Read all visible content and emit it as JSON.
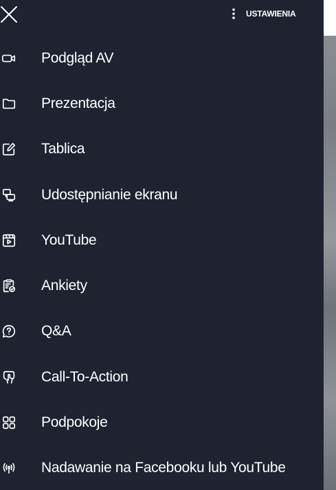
{
  "header": {
    "close_icon": "close-icon",
    "settings_icon": "more-vertical-icon",
    "settings_label": "USTAWIENIA"
  },
  "menu": {
    "items": [
      {
        "label": "Podgląd AV",
        "icon": "video-camera-icon"
      },
      {
        "label": "Prezentacja",
        "icon": "folder-icon"
      },
      {
        "label": "Tablica",
        "icon": "edit-icon"
      },
      {
        "label": "Udostępnianie ekranu",
        "icon": "screen-share-icon"
      },
      {
        "label": "YouTube",
        "icon": "video-player-icon"
      },
      {
        "label": "Ankiety",
        "icon": "poll-clipboard-icon"
      },
      {
        "label": "Q&A",
        "icon": "question-bubble-icon"
      },
      {
        "label": "Call-To-Action",
        "icon": "touch-icon"
      },
      {
        "label": "Podpokoje",
        "icon": "grid-icon"
      },
      {
        "label": "Nadawanie na Facebooku lub YouTube",
        "icon": "broadcast-icon"
      }
    ]
  },
  "colors": {
    "drawer_background": "#1f2330",
    "text": "#ffffff",
    "backdrop_top": "#ffffff"
  }
}
